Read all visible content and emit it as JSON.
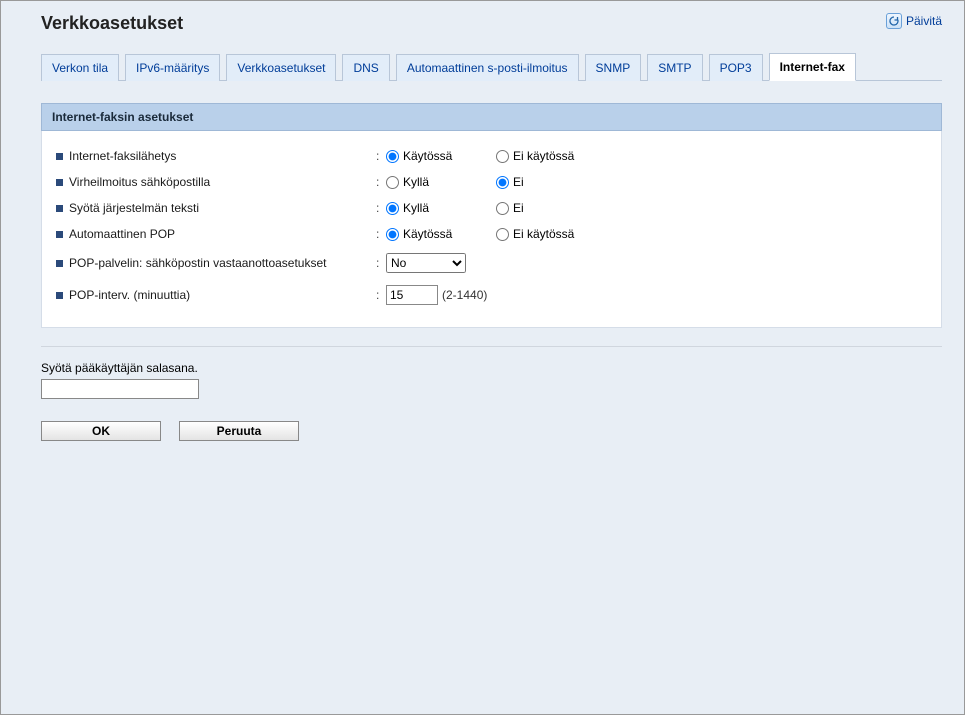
{
  "header": {
    "title": "Verkkoasetukset",
    "refresh_label": "Päivitä"
  },
  "tabs": [
    {
      "label": "Verkon tila",
      "active": false
    },
    {
      "label": "IPv6-määritys",
      "active": false
    },
    {
      "label": "Verkkoasetukset",
      "active": false
    },
    {
      "label": "DNS",
      "active": false
    },
    {
      "label": "Automaattinen s-posti-ilmoitus",
      "active": false
    },
    {
      "label": "SNMP",
      "active": false
    },
    {
      "label": "SMTP",
      "active": false
    },
    {
      "label": "POP3",
      "active": false
    },
    {
      "label": "Internet-fax",
      "active": true
    }
  ],
  "panel": {
    "title": "Internet-faksin asetukset",
    "rows": {
      "send": {
        "label": "Internet-faksilähetys",
        "opt1": "Käytössä",
        "opt2": "Ei käytössä",
        "selected": 1
      },
      "error_mail": {
        "label": "Virheilmoitus sähköpostilla",
        "opt1": "Kyllä",
        "opt2": "Ei",
        "selected": 2
      },
      "system_text": {
        "label": "Syötä järjestelmän teksti",
        "opt1": "Kyllä",
        "opt2": "Ei",
        "selected": 1
      },
      "auto_pop": {
        "label": "Automaattinen POP",
        "opt1": "Käytössä",
        "opt2": "Ei käytössä",
        "selected": 1
      },
      "pop_server": {
        "label": "POP-palvelin: sähköpostin vastaanottoasetukset",
        "value": "No"
      },
      "pop_interval": {
        "label": "POP-interv. (minuuttia)",
        "value": "15",
        "hint": "(2-1440)"
      }
    }
  },
  "footer": {
    "password_prompt": "Syötä pääkäyttäjän salasana.",
    "password_value": "",
    "ok_label": "OK",
    "cancel_label": "Peruuta"
  }
}
